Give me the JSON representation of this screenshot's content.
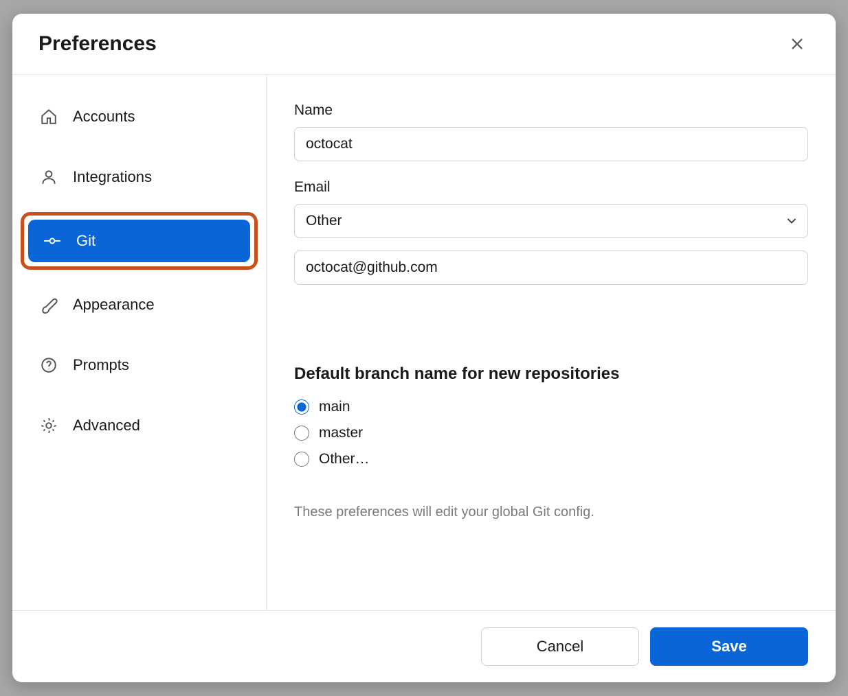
{
  "dialog": {
    "title": "Preferences"
  },
  "sidebar": {
    "items": [
      {
        "id": "accounts",
        "label": "Accounts"
      },
      {
        "id": "integrations",
        "label": "Integrations"
      },
      {
        "id": "git",
        "label": "Git"
      },
      {
        "id": "appearance",
        "label": "Appearance"
      },
      {
        "id": "prompts",
        "label": "Prompts"
      },
      {
        "id": "advanced",
        "label": "Advanced"
      }
    ],
    "active": "git",
    "highlighted": "git"
  },
  "git": {
    "name_label": "Name",
    "name_value": "octocat",
    "email_label": "Email",
    "email_select_value": "Other",
    "email_input_value": "octocat@github.com",
    "default_branch_heading": "Default branch name for new repositories",
    "branch_options": [
      {
        "label": "main",
        "selected": true
      },
      {
        "label": "master",
        "selected": false
      },
      {
        "label": "Other…",
        "selected": false
      }
    ],
    "help_text": "These preferences will edit your global Git config."
  },
  "footer": {
    "cancel_label": "Cancel",
    "save_label": "Save"
  }
}
